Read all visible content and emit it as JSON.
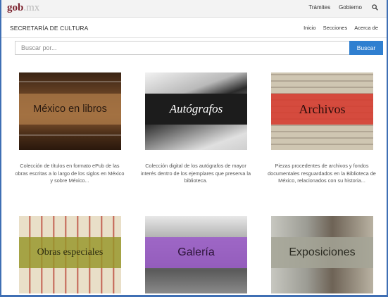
{
  "gov_bar": {
    "logo_main": "gob",
    "logo_suffix": ".mx",
    "nav": [
      "Trámites",
      "Gobierno"
    ],
    "search_icon": "search-icon"
  },
  "secretaria": {
    "title": "SECRETARÍA DE CULTURA",
    "nav": [
      "Inicio",
      "Secciones",
      "Acerca de"
    ]
  },
  "search": {
    "placeholder": "Buscar por...",
    "button_label": "Buscar"
  },
  "cards": [
    {
      "title": "México en libros",
      "description": "Colección de títulos en formato ePub de las obras escritas a lo largo de los siglos en México y sobre México..."
    },
    {
      "title": "Autógrafos",
      "description": "Colección digital de los autógrafos de mayor interés dentro de los ejemplares que preserva la biblioteca."
    },
    {
      "title": "Archivos",
      "description": "Piezas procedentes de archivos y fondos documentales resguardados en la Biblioteca de México, relacionados con su historia..."
    },
    {
      "title": "Obras especiales",
      "description": ""
    },
    {
      "title": "Galería",
      "description": ""
    },
    {
      "title": "Exposiciones",
      "description": ""
    }
  ],
  "colors": {
    "accent": "#2f7fd0",
    "frame": "#3f6fb4",
    "logo": "#7a1f2b"
  }
}
